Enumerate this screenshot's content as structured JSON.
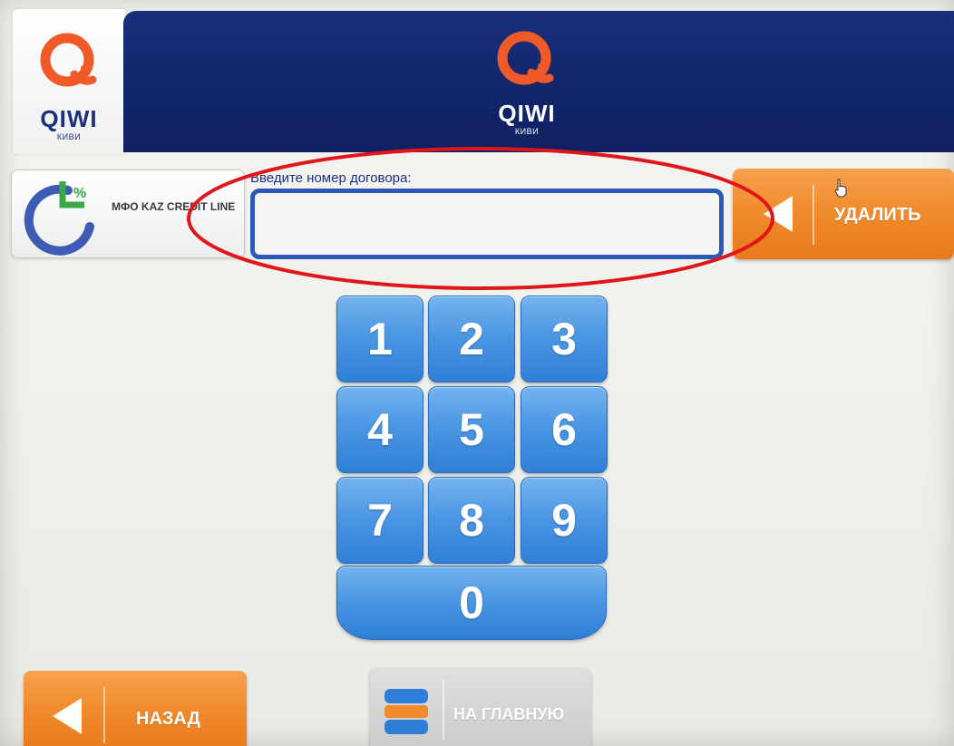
{
  "header": {
    "logo_text": "QIWI",
    "logo_subtext": "КИВИ",
    "banner_text": "QIWI",
    "banner_subtext": "КИВИ"
  },
  "provider": {
    "name": "МФО KAZ CREDIT LINE",
    "icon": "provider-logo-icon"
  },
  "form": {
    "prompt": "Введите номер договора:",
    "contract_number_value": "",
    "contract_number_placeholder": ""
  },
  "buttons": {
    "delete_label": "УДАЛИТЬ",
    "back_label": "НАЗАД",
    "home_label": "НА ГЛАВНУЮ"
  },
  "keypad": {
    "keys": [
      "1",
      "2",
      "3",
      "4",
      "5",
      "6",
      "7",
      "8",
      "9",
      "0"
    ]
  },
  "colors": {
    "brand_orange": "#f08a2b",
    "brand_navy": "#13266c",
    "key_blue": "#4c97e4",
    "annotation_red": "#e0161b"
  }
}
